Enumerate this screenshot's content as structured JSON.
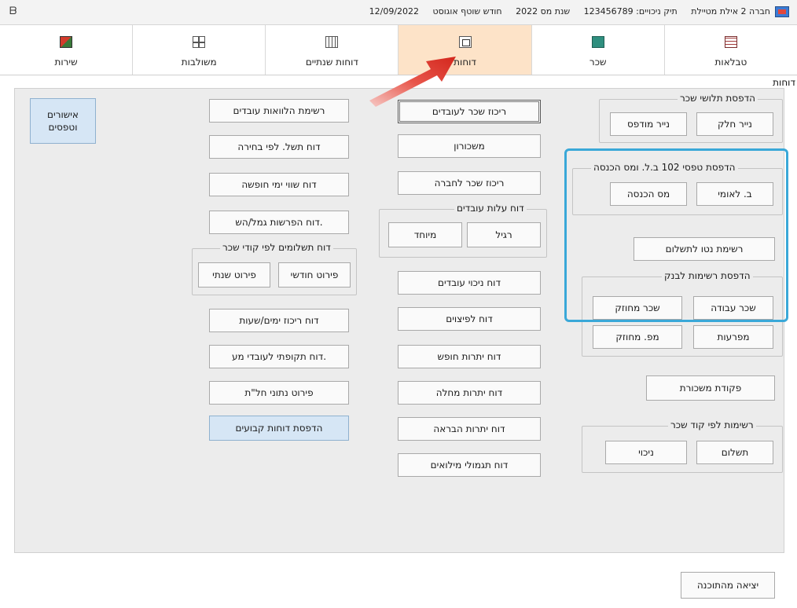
{
  "titlebar": {
    "company": "חברה 2 אילת מטיילת",
    "file": "תיק ניכויים: 123456789",
    "tax_year": "שנת מס 2022",
    "month": "חודש שוטף אוגוסט",
    "date": "12/09/2022"
  },
  "tabs": [
    {
      "label": "טבלאות",
      "icon": "table-icon"
    },
    {
      "label": "שכר",
      "icon": "payroll-icon"
    },
    {
      "label": "דוחות",
      "icon": "reports-icon",
      "active": true
    },
    {
      "label": "דוחות שנתיים",
      "icon": "annual-reports-icon"
    },
    {
      "label": "משולבות",
      "icon": "combined-icon"
    },
    {
      "label": "שירות",
      "icon": "service-icon"
    }
  ],
  "section_title": "דוחות",
  "groups": {
    "payslip_print": {
      "title": "הדפסת תלושי שכר",
      "plain": "נייר חלק",
      "printed": "נייר מודפס"
    },
    "form102": {
      "title": "הדפסת טפסי 102 ב.ל. ומס הכנסה",
      "nat_ins": "ב. לאומי",
      "income_tax": "מס הכנסה"
    },
    "net_list": "רשימת נטו לתשלום",
    "bank_lists": {
      "title": "הדפסת רשימות לבנק",
      "work_pay": "שכר עבודה",
      "rec_pay": "שכר מחוזק",
      "installments": "מפרעות",
      "rec_pension": "מפ. מחוזק"
    },
    "pay_order": "פקודת משכורת",
    "by_code": {
      "title": "רשימות לפי קוד שכר",
      "payment": "תשלום",
      "deduction": "ניכוי"
    },
    "employee_cost": {
      "title": "דוח עלות עובדים",
      "regular": "רגיל",
      "special": "מיוחד"
    },
    "payments_by_code": {
      "title": "דוח תשלומים לפי קודי שכר",
      "monthly": "פירוט חודשי",
      "yearly": "פירוט שנתי"
    }
  },
  "col_middle": [
    "ריכוז שכר לעובדים",
    "משכורון",
    "ריכוז שכר לחברה",
    "דוח ניכוי עובדים",
    "דוח לפיצוים",
    "דוח יתרות חופש",
    "דוח יתרות מחלה",
    "דוח יתרות הבראה",
    "דוח תגמולי מילואים"
  ],
  "col_left": [
    "רשימת הלוואות עובדים",
    "דוח תשל. לפי בחירה",
    "דוח שווי ימי חופשה",
    "דוח הפרשות גמל/הש.",
    "דוח ריכוז ימים/שעות",
    "דוח תקופתי לעובדי מע.",
    "פירוט נתוני חל\"ת",
    "הדפסת דוחות קבועים"
  ],
  "approvals": "אישורים וטפסים",
  "exit": "יציאה מהתוכנה",
  "colors": {
    "active_tab": "#fde3c8",
    "highlight": "#3aa8d8",
    "arrow": "#e0352b",
    "blue_button": "#d6e6f5"
  }
}
